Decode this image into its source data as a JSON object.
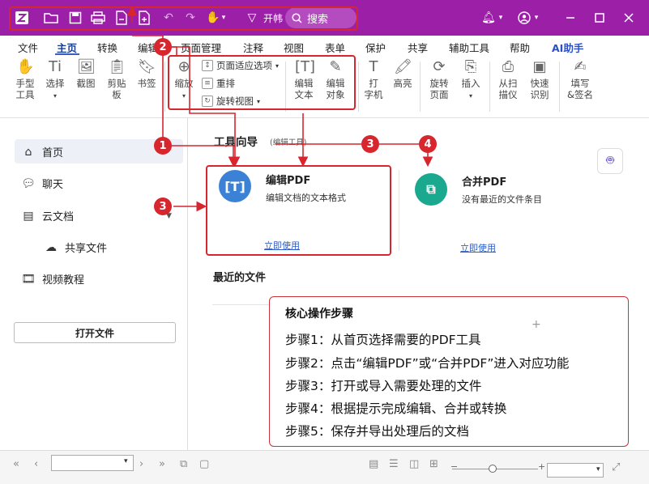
{
  "titlebar": {
    "open_label": "开帏",
    "search_placeholder": "搜索"
  },
  "menu": {
    "items": [
      "文件",
      "主页",
      "转换",
      "编辑",
      "页面管理",
      "注释",
      "视图",
      "表单",
      "保护",
      "共享",
      "辅助工具",
      "帮助",
      "AI助手"
    ],
    "active": "主页"
  },
  "ribbon": {
    "hand_tool": "手型\n工具",
    "select": "选择",
    "snapshot": "截图",
    "clipboard": "剪贴\n板",
    "bookmark": "书签",
    "zoom": "缩放",
    "fit_page": "页面适应选项",
    "reflow": "重排",
    "rotate_view": "旋转视图",
    "edit_text": "编辑\n文本",
    "edit_object": "编辑\n对象",
    "typewriter": "打\n字机",
    "highlight": "高亮",
    "rotate_page": "旋转\n页面",
    "insert": "插入",
    "from_scanner": "从扫\n描仪",
    "quick_ocr": "快速\n识别",
    "fill_sign": "填写\n&签名"
  },
  "sidebar": {
    "home": "首页",
    "chat": "聊天",
    "cloud_docs": "云文档",
    "shared_files": "共享文件",
    "video_tutorials": "视频教程",
    "open_file": "打开文件"
  },
  "main": {
    "guide_title": "工具向导",
    "guide_subtitle": "(编辑工具)",
    "cards": [
      {
        "name": "编辑PDF",
        "desc": "编辑文档的文本格式",
        "link": "立即使用",
        "icon_color": "#3b82d6"
      },
      {
        "name": "合并PDF",
        "desc": "没有最近的文件条目",
        "link": "立即使用",
        "icon_color": "#1aa88f"
      }
    ],
    "recent_title": "最近的文件"
  },
  "steps": {
    "title": "核心操作步骤",
    "items": [
      "步骤1：从首页选择需要的PDF工具",
      "步骤2：点击“编辑PDF”或“合并PDF”进入对应功能",
      "步骤3：打开或导入需要处理的文件",
      "步骤4：根据提示完成编辑、合并或转换",
      "步骤5：保存并导出处理后的文档"
    ]
  },
  "badges": [
    "1",
    "2",
    "3",
    "3",
    "4"
  ],
  "colors": {
    "titlebar": "#9c1fa8",
    "annotation_red": "#d7262e",
    "link_blue": "#2b5cc8"
  }
}
